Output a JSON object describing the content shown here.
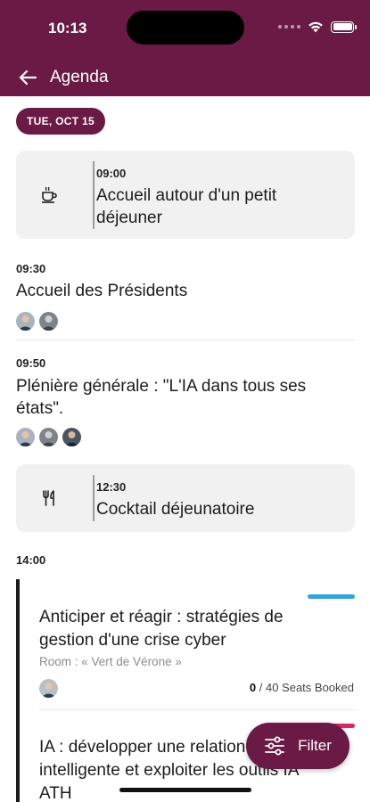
{
  "status_bar": {
    "time": "10:13"
  },
  "nav": {
    "title": "Agenda"
  },
  "date_chip": "TUE, OCT 15",
  "breaks": [
    {
      "time": "09:00",
      "title": "Accueil autour d'un petit déjeuner",
      "icon": "coffee-cup-icon"
    },
    {
      "time": "12:30",
      "title": "Cocktail déjeunatoire",
      "icon": "fork-knife-icon"
    }
  ],
  "sessions": [
    {
      "time": "09:30",
      "title": "Accueil des Présidents",
      "speaker_count": 2
    },
    {
      "time": "09:50",
      "title": "Plénière générale : \"L'IA dans tous ses états\".",
      "speaker_count": 3
    }
  ],
  "track_group": {
    "time": "14:00",
    "items": [
      {
        "title": "Anticiper et réagir : stratégies de gestion d'une crise cyber",
        "room": "Room : « Vert de Vérone »",
        "seats_booked": "0",
        "seats_rest": " / 40 Seats Booked",
        "accent": "#29a8e0"
      },
      {
        "title": "IA : développer une relation intelligente et exploiter les outils IA ATH",
        "accent": "#e0245e"
      }
    ]
  },
  "filter_button": {
    "label": "Filter"
  },
  "colors": {
    "brand": "#6b1a45",
    "card_bg": "#f1f1f1"
  }
}
